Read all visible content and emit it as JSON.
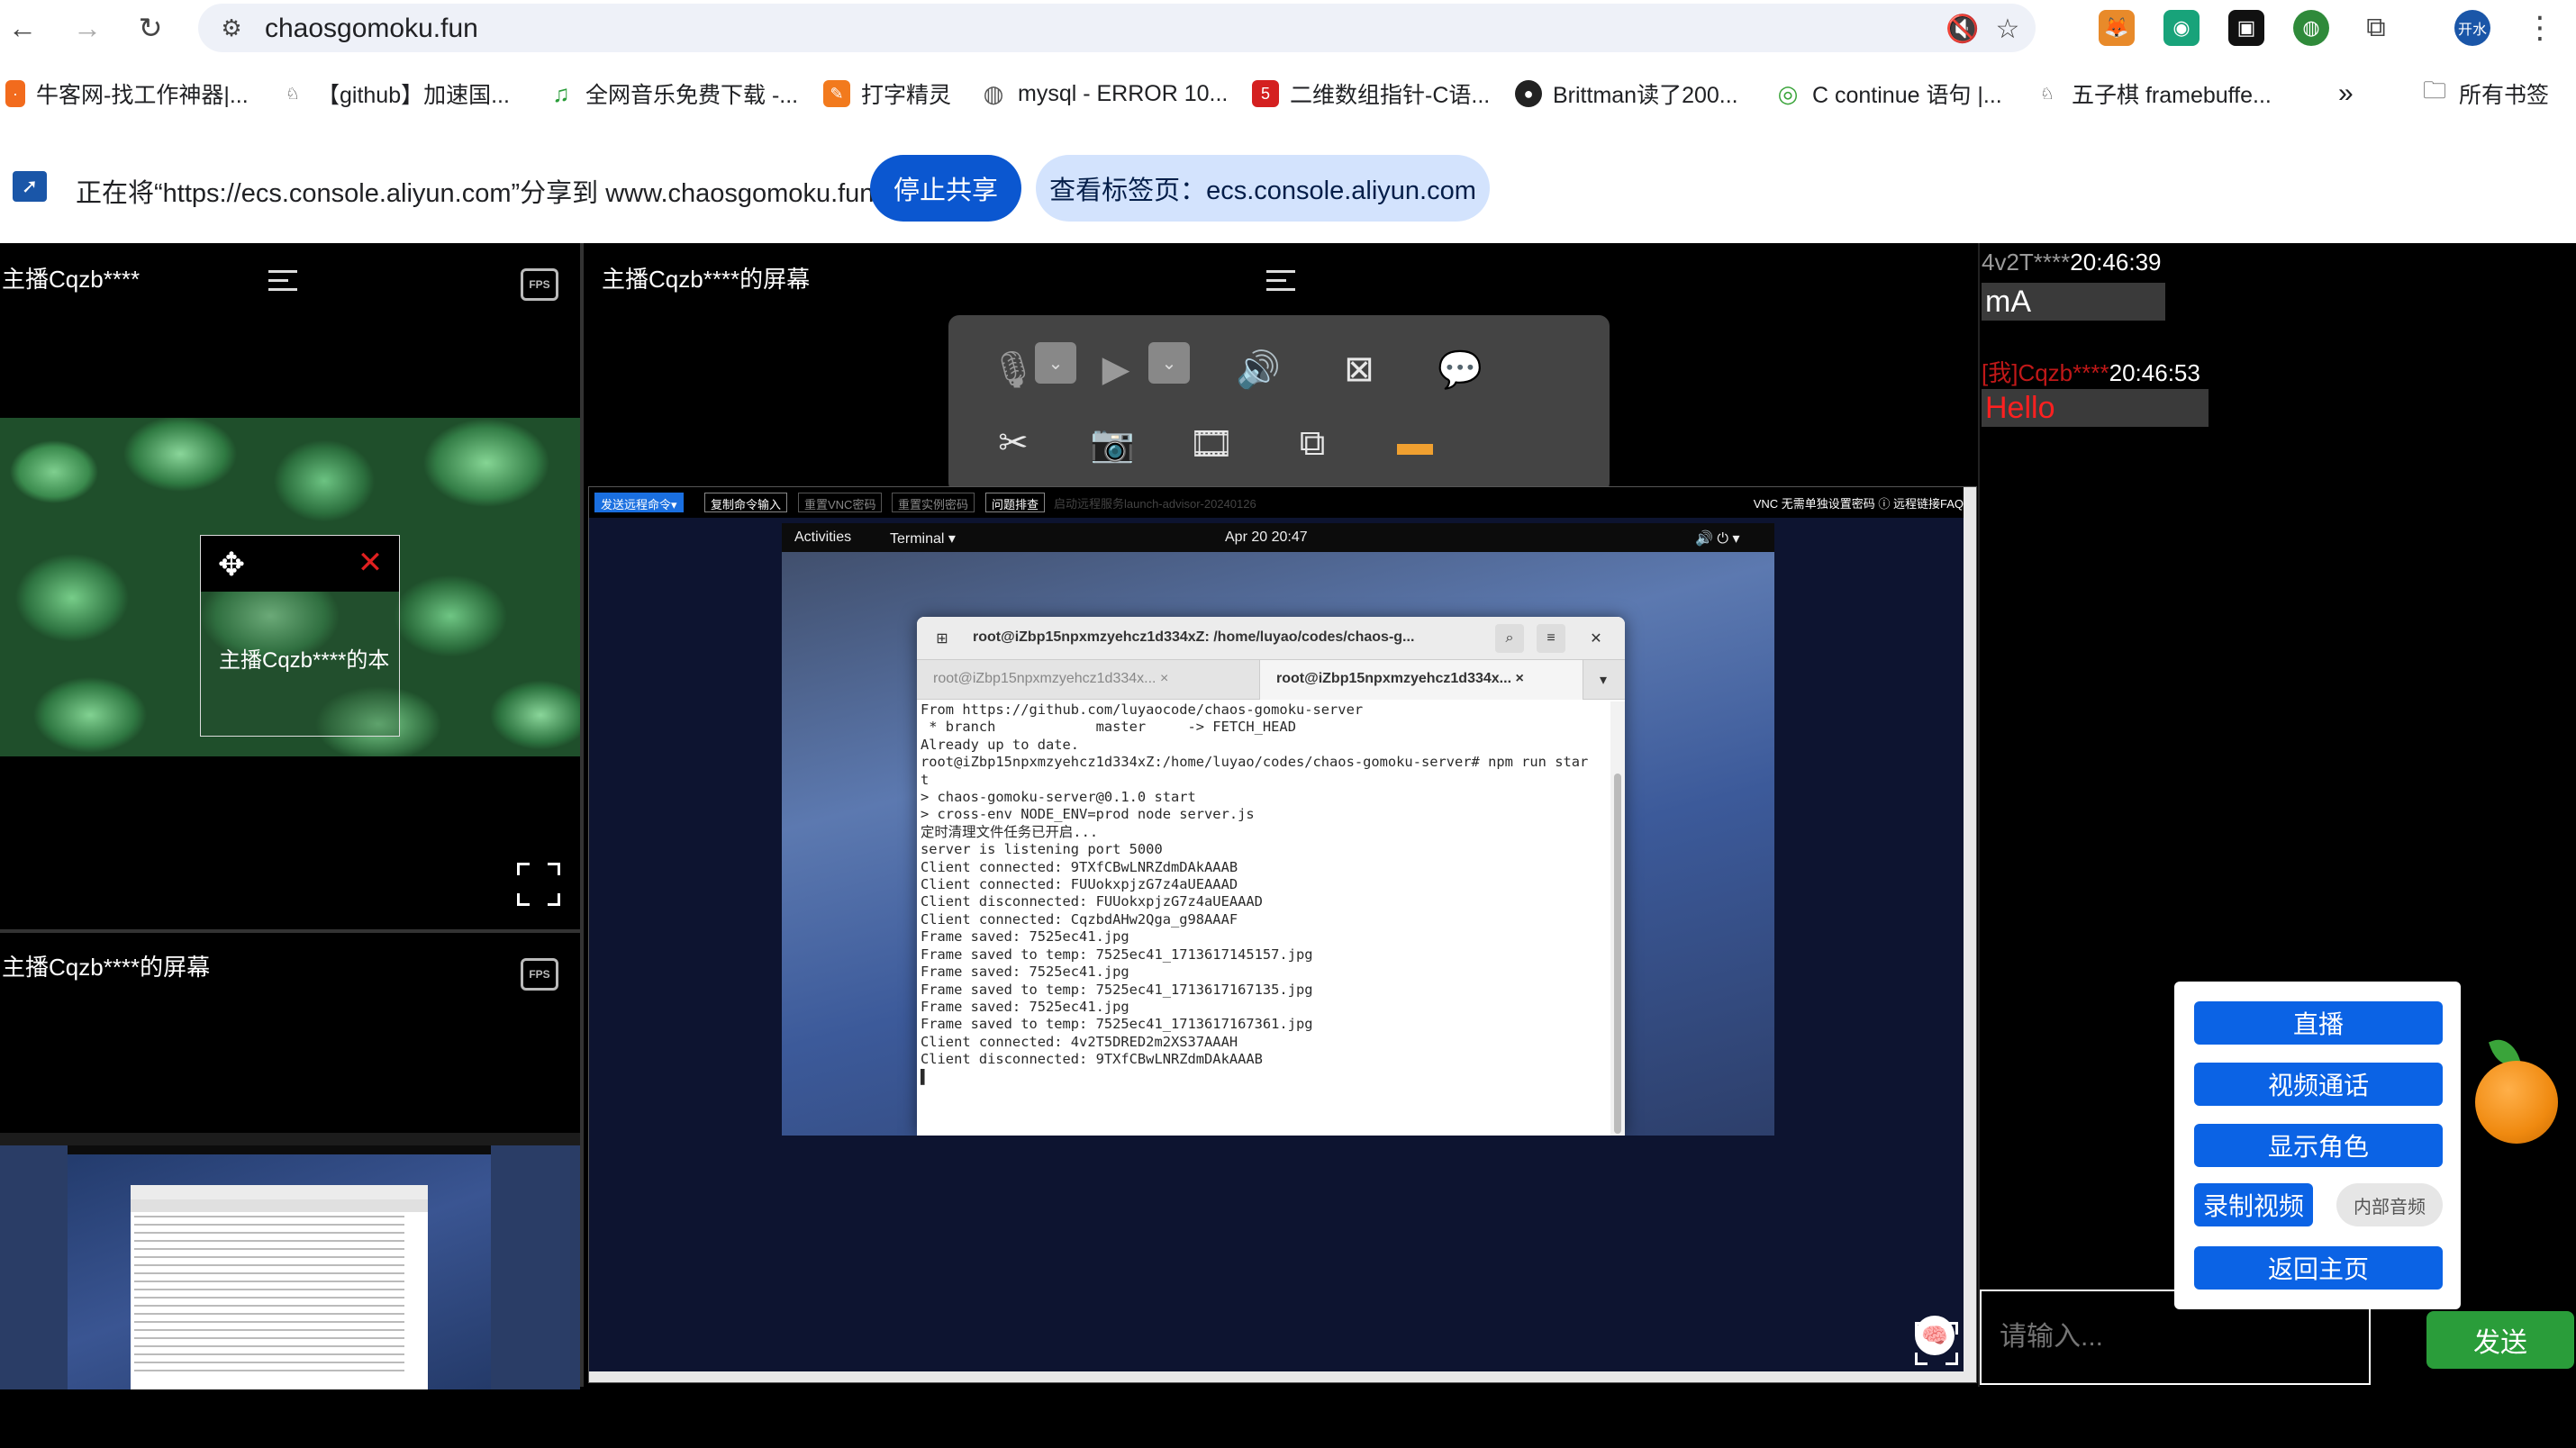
{
  "browser": {
    "url": "chaosgomoku.fun",
    "profile_label": "开水",
    "bookmarks": [
      {
        "label": "牛客网-找工作神器|..."
      },
      {
        "label": "【github】加速国..."
      },
      {
        "label": "全网音乐免费下载 -..."
      },
      {
        "label": "打字精灵"
      },
      {
        "label": "mysql - ERROR 10..."
      },
      {
        "label": "二维数组指针-C语..."
      },
      {
        "label": "Brittman读了200..."
      },
      {
        "label": "C continue 语句 |..."
      },
      {
        "label": "五子棋 framebuffe..."
      }
    ],
    "more_bookmarks": "»",
    "all_bookmarks": "所有书签"
  },
  "sharing": {
    "text": "正在将“https://ecs.console.aliyun.com”分享到 www.chaosgomoku.fun",
    "stop_label": "停止共享",
    "view_label": "查看标签页：ecs.console.aliyun.com"
  },
  "left": {
    "camera_title": "主播Cqzb****",
    "float_label": "主播Cqzb****的本",
    "screen_title": "主播Cqzb****的屏幕"
  },
  "main": {
    "title": "主播Cqzb****的屏幕"
  },
  "remote": {
    "toolbar_buttons": [
      "发送远程命令▾",
      "复制命令输入",
      "重置VNC密码",
      "重置实例密码",
      "问题排查"
    ],
    "faded_text": "启动远程服务launch-advisor-20240126",
    "right_text": "VNC 无需单独设置密码   ⓘ 远程链接FAQ",
    "gnome": {
      "activities": "Activities",
      "app": "Terminal ▾",
      "clock": "Apr 20  20:47",
      "status": "🔊 ⏻ ▾"
    },
    "terminal": {
      "title": "root@iZbp15npxmzyehcz1d334xZ: /home/luyao/codes/chaos-g...",
      "tab1": "root@iZbp15npxmzyehcz1d334x...",
      "tab2": "root@iZbp15npxmzyehcz1d334x...",
      "lines": [
        "From https://github.com/luyaocode/chaos-gomoku-server",
        " * branch            master     -> FETCH_HEAD",
        "Already up to date.",
        "root@iZbp15npxmzyehcz1d334xZ:/home/luyao/codes/chaos-gomoku-server# npm run star",
        "t",
        "",
        "> chaos-gomoku-server@0.1.0 start",
        "> cross-env NODE_ENV=prod node server.js",
        "",
        "定时清理文件任务已开启...",
        "server is listening port 5000",
        "Client connected: 9TXfCBwLNRZdmDAkAAAB",
        "Client connected: FUUokxpjzG7z4aUEAAAD",
        "Client disconnected: FUUokxpjzG7z4aUEAAAD",
        "Client connected: CqzbdAHw2Qga_g98AAAF",
        "Frame saved: 7525ec41.jpg",
        "Frame saved to temp: 7525ec41_1713617145157.jpg",
        "Frame saved: 7525ec41.jpg",
        "Frame saved to temp: 7525ec41_1713617167135.jpg",
        "Frame saved: 7525ec41.jpg",
        "Frame saved to temp: 7525ec41_1713617167361.jpg",
        "Client connected: 4v2T5DRED2m2XS37AAAH",
        "Client disconnected: 9TXfCBwLNRZdmDAkAAAB",
        "▌"
      ]
    }
  },
  "chat": {
    "messages": [
      {
        "user": "4v2T****",
        "time": "20:46:39",
        "text": "mA",
        "user_color": "#9a9a9a",
        "text_color": "#ffffff"
      },
      {
        "user": "[我]Cqzb****",
        "time": "20:46:53",
        "text": "Hello",
        "user_color": "#c01818",
        "text_color": "#ff2020"
      }
    ],
    "input_placeholder": "请输入...",
    "send_label": "发送"
  },
  "mode_menu": {
    "live": "直播",
    "video_call": "视频通话",
    "show_role": "显示角色",
    "record": "录制视频",
    "internal_audio": "内部音频",
    "home": "返回主页"
  },
  "colors": {
    "primary_blue": "#0b63e5",
    "send_green": "#2a9d3a",
    "chrome_blue": "#0b57d0"
  }
}
